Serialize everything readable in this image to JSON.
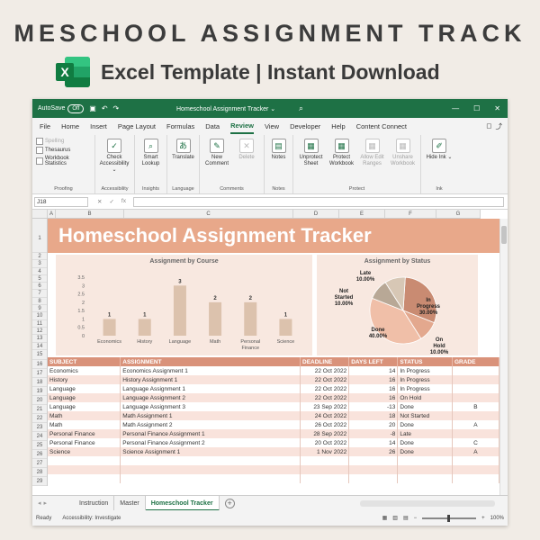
{
  "promo": {
    "title": "MESCHOOL ASSIGNMENT TRACK",
    "subtitle": "Excel Template | Instant Download"
  },
  "window": {
    "autosave_label": "AutoSave",
    "autosave_state": "Off",
    "doc_title": "Homeschool Assignment Tracker ⌄",
    "colors": {
      "titlebar": "#1e7145",
      "banner": "#e8a88a",
      "header": "#d9927a"
    }
  },
  "tabs": [
    "File",
    "Home",
    "Insert",
    "Page Layout",
    "Formulas",
    "Data",
    "Review",
    "View",
    "Developer",
    "Help",
    "Content Connect"
  ],
  "active_tab": "Review",
  "ribbon": {
    "proofing": {
      "items": [
        "Spelling",
        "Thesaurus",
        "Workbook Statistics"
      ],
      "label": "Proofing"
    },
    "accessibility": {
      "button": "Check Accessibility ⌄",
      "label": "Accessibility"
    },
    "insights": {
      "button": "Smart Lookup",
      "label": "Insights"
    },
    "language": {
      "button": "Translate",
      "label": "Language"
    },
    "comments": {
      "new": "New Comment",
      "delete": "Delete",
      "label": "Comments"
    },
    "notes": {
      "button": "Notes",
      "label": "Notes"
    },
    "protect": {
      "unprotect": "Unprotect Sheet",
      "protect": "Protect Workbook",
      "allow": "Allow Edit Ranges",
      "unshare": "Unshare Workbook",
      "label": "Protect"
    },
    "ink": {
      "button": "Hide Ink ⌄",
      "label": "Ink"
    }
  },
  "formula_bar": {
    "cell_ref": "J18",
    "fx": "fx"
  },
  "columns": [
    "A",
    "B",
    "C",
    "D",
    "E",
    "F",
    "G"
  ],
  "rows": [
    "1",
    "2",
    "3",
    "4",
    "5",
    "6",
    "7",
    "8",
    "9",
    "10",
    "11",
    "12",
    "13",
    "14",
    "15",
    "16",
    "17",
    "18",
    "19",
    "20",
    "21",
    "22",
    "23",
    "24",
    "25",
    "26",
    "27",
    "28",
    "29"
  ],
  "banner_title": "Homeschool Assignment Tracker",
  "chart_data": [
    {
      "type": "bar",
      "title": "Assignment by Course",
      "categories": [
        "Economics",
        "History",
        "Language",
        "Math",
        "Personal Finance",
        "Science"
      ],
      "values": [
        1,
        1,
        3,
        2,
        2,
        1
      ],
      "ylim": [
        0,
        3.5
      ],
      "yticks": [
        "0",
        "0.5",
        "1",
        "1.5",
        "2",
        "2.5",
        "3",
        "3.5"
      ],
      "color": "#dcc2ad"
    },
    {
      "type": "pie",
      "title": "Assignment by Status",
      "slices": [
        {
          "label": "In Progress",
          "pct": "30.00%",
          "value": 30,
          "color": "#c98b72"
        },
        {
          "label": "On Hold",
          "pct": "10.00%",
          "value": 10,
          "color": "#e3a88e"
        },
        {
          "label": "Done",
          "pct": "40.00%",
          "value": 40,
          "color": "#f0bfa8"
        },
        {
          "label": "Not Started",
          "pct": "10.00%",
          "value": 10,
          "color": "#b8a896"
        },
        {
          "label": "Late",
          "pct": "10.00%",
          "value": 10,
          "color": "#d7c7b5"
        }
      ]
    }
  ],
  "table": {
    "headers": [
      "SUBJECT",
      "ASSIGNMENT",
      "DEADLINE",
      "DAYS LEFT",
      "STATUS",
      "GRADE"
    ],
    "rows": [
      [
        "Economics",
        "Economics Assignment 1",
        "22 Oct 2022",
        "14",
        "In Progress",
        ""
      ],
      [
        "History",
        "History Assignment 1",
        "22 Oct 2022",
        "16",
        "In Progress",
        ""
      ],
      [
        "Language",
        "Language Assignment 1",
        "22 Oct 2022",
        "16",
        "In Progress",
        ""
      ],
      [
        "Language",
        "Language Assignment 2",
        "22 Oct 2022",
        "16",
        "On Hold",
        ""
      ],
      [
        "Language",
        "Language Assignment 3",
        "23 Sep 2022",
        "-13",
        "Done",
        "B"
      ],
      [
        "Math",
        "Math Assignment 1",
        "24 Oct 2022",
        "18",
        "Not Started",
        ""
      ],
      [
        "Math",
        "Math Assignment 2",
        "26 Oct 2022",
        "20",
        "Done",
        "A"
      ],
      [
        "Personal Finance",
        "Personal Finance Assignment 1",
        "28 Sep 2022",
        "-8",
        "Late",
        ""
      ],
      [
        "Personal Finance",
        "Personal Finance Assignment 2",
        "20 Oct 2022",
        "14",
        "Done",
        "C"
      ],
      [
        "Science",
        "Science Assignment 1",
        "1 Nov 2022",
        "26",
        "Done",
        "A"
      ],
      [
        "",
        "",
        "",
        "",
        "",
        ""
      ],
      [
        "",
        "",
        "",
        "",
        "",
        ""
      ],
      [
        "",
        "",
        "",
        "",
        "",
        ""
      ]
    ]
  },
  "sheet_tabs": [
    "Instruction",
    "Master",
    "Homeschool Tracker"
  ],
  "active_sheet": "Homeschool Tracker",
  "status": {
    "ready": "Ready",
    "accessibility": "Accessibility: Investigate",
    "zoom": "100%"
  }
}
